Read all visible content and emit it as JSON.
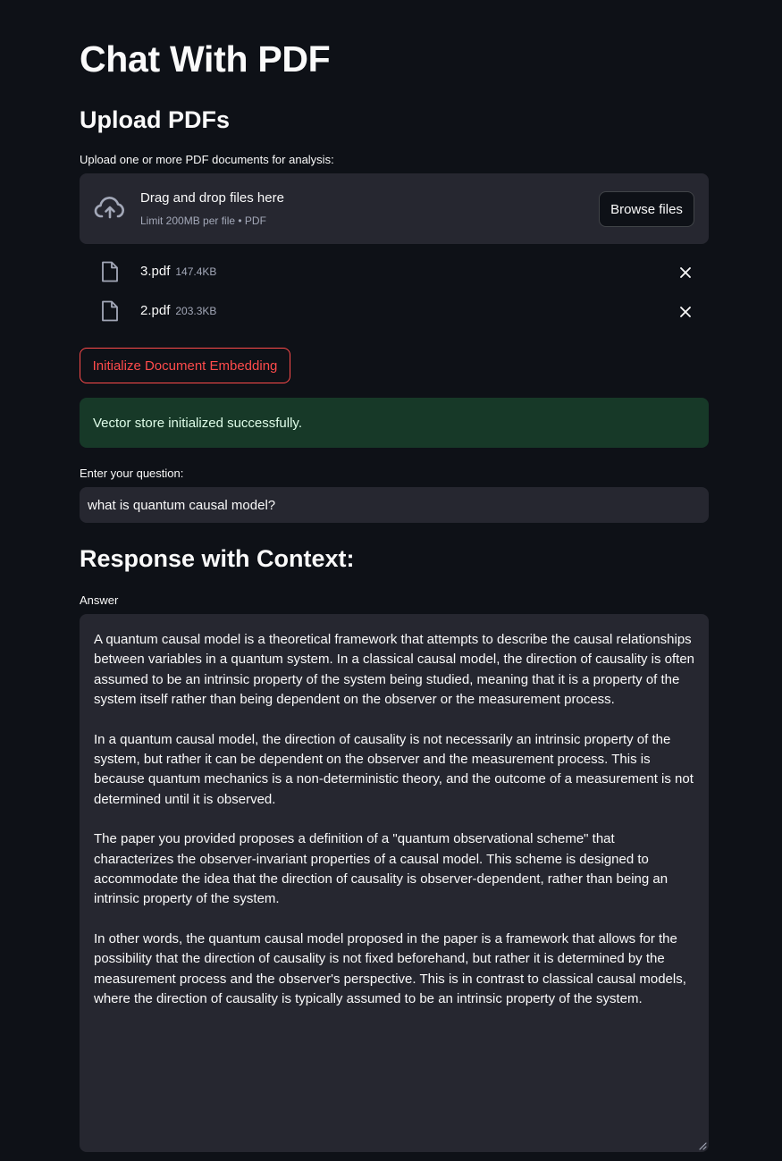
{
  "page": {
    "title": "Chat With PDF",
    "upload_heading": "Upload PDFs",
    "upload_label": "Upload one or more PDF documents for analysis:"
  },
  "dropzone": {
    "title": "Drag and drop files here",
    "subtitle": "Limit 200MB per file • PDF",
    "browse_label": "Browse files",
    "icon": "cloud-upload-icon"
  },
  "files": [
    {
      "name": "3.pdf",
      "size": "147.4KB",
      "icon": "file-icon"
    },
    {
      "name": "2.pdf",
      "size": "203.3KB",
      "icon": "file-icon"
    }
  ],
  "init_button": {
    "label": "Initialize Document Embedding"
  },
  "status": {
    "message": "Vector store initialized successfully."
  },
  "question": {
    "label": "Enter your question:",
    "value": "what is  quantum causal model?"
  },
  "response": {
    "heading": "Response with Context:",
    "answer_label": "Answer",
    "paragraphs": [
      "A quantum causal model is a theoretical framework that attempts to describe the causal relationships between variables in a quantum system. In a classical causal model, the direction of causality is often assumed to be an intrinsic property of the system being studied, meaning that it is a property of the system itself rather than being dependent on the observer or the measurement process.",
      "In a quantum causal model, the direction of causality is not necessarily an intrinsic property of the system, but rather it can be dependent on the observer and the measurement process. This is because quantum mechanics is a non-deterministic theory, and the outcome of a measurement is not determined until it is observed.",
      "The paper you provided proposes a definition of a \"quantum observational scheme\" that characterizes the observer-invariant properties of a causal model. This scheme is designed to accommodate the idea that the direction of causality is observer-dependent, rather than being an intrinsic property of the system.",
      "In other words, the quantum causal model proposed in the paper is a framework that allows for the possibility that the direction of causality is not fixed beforehand, but rather it is determined by the measurement process and the observer's perspective. This is in contrast to classical causal models, where the direction of causality is typically assumed to be an intrinsic property of the system."
    ]
  },
  "colors": {
    "background": "#0e1117",
    "surface": "#262730",
    "accent": "#ff4b4b",
    "success_bg": "#173928"
  }
}
